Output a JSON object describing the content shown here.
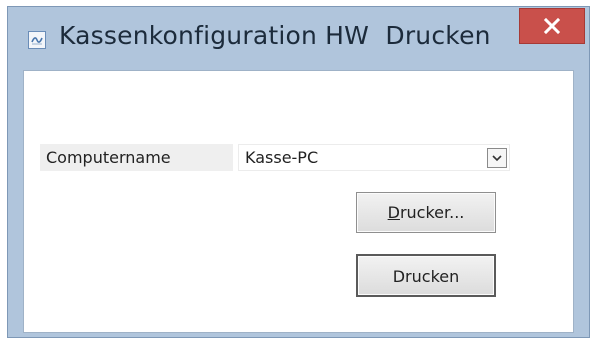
{
  "window": {
    "title": "Kassenkonfiguration HW  Drucken",
    "app_icon": "app-form-icon",
    "close_icon": "close-icon"
  },
  "form": {
    "computer_label": "Computername",
    "computer_value": "Kasse-PC",
    "dropdown_icon": "chevron-down-icon",
    "printer_button_mnemonic": "D",
    "printer_button_rest": "rucker...",
    "print_button_label": "Drucken"
  },
  "colors": {
    "title_background": "#b0c5dc",
    "close_button": "#c9504b"
  }
}
